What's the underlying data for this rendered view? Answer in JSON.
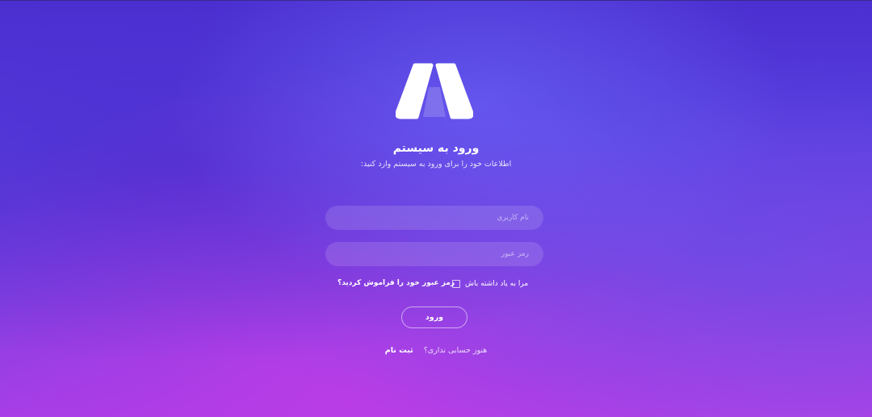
{
  "brand": {
    "logo_icon": "stylized-A-logo-icon"
  },
  "login": {
    "title": "ورود به سیستم",
    "subtitle": "اطلاعات خود را برای ورود به سیستم وارد کنید:",
    "username": {
      "value": "",
      "placeholder": "نام کاربری"
    },
    "password": {
      "value": "",
      "placeholder": "رمز عبور"
    },
    "remember_label": "مرا به یاد داشته باش",
    "remember_checked": false,
    "forgot_label": "رمز عبور خود را فراموش کردید؟",
    "submit_label": "ورود",
    "signup_question": "هنوز حسابی نداری؟",
    "signup_label": "ثبت نام"
  }
}
